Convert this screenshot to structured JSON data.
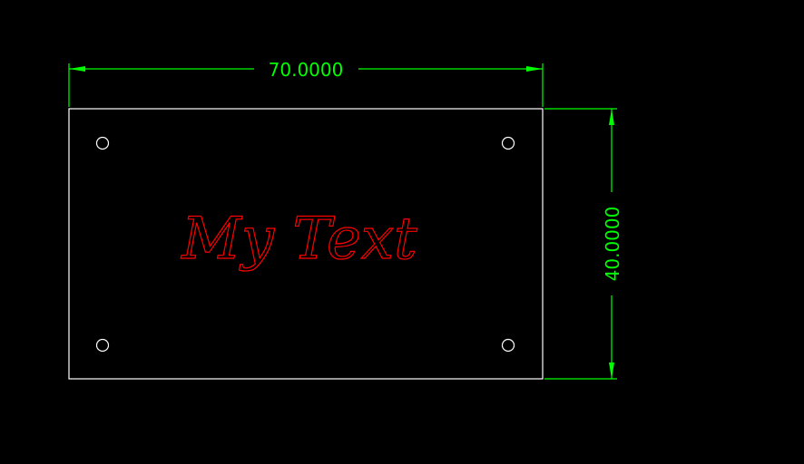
{
  "drawing": {
    "width_dimension": "70.0000",
    "height_dimension": "40.0000",
    "engraving_text": "My Text"
  },
  "colors": {
    "background": "#000000",
    "plate_outline": "#ffffff",
    "dimension": "#00ff00",
    "engraving": "#ff0000",
    "hole": "#ffffff"
  },
  "holes": {
    "count": 4
  }
}
